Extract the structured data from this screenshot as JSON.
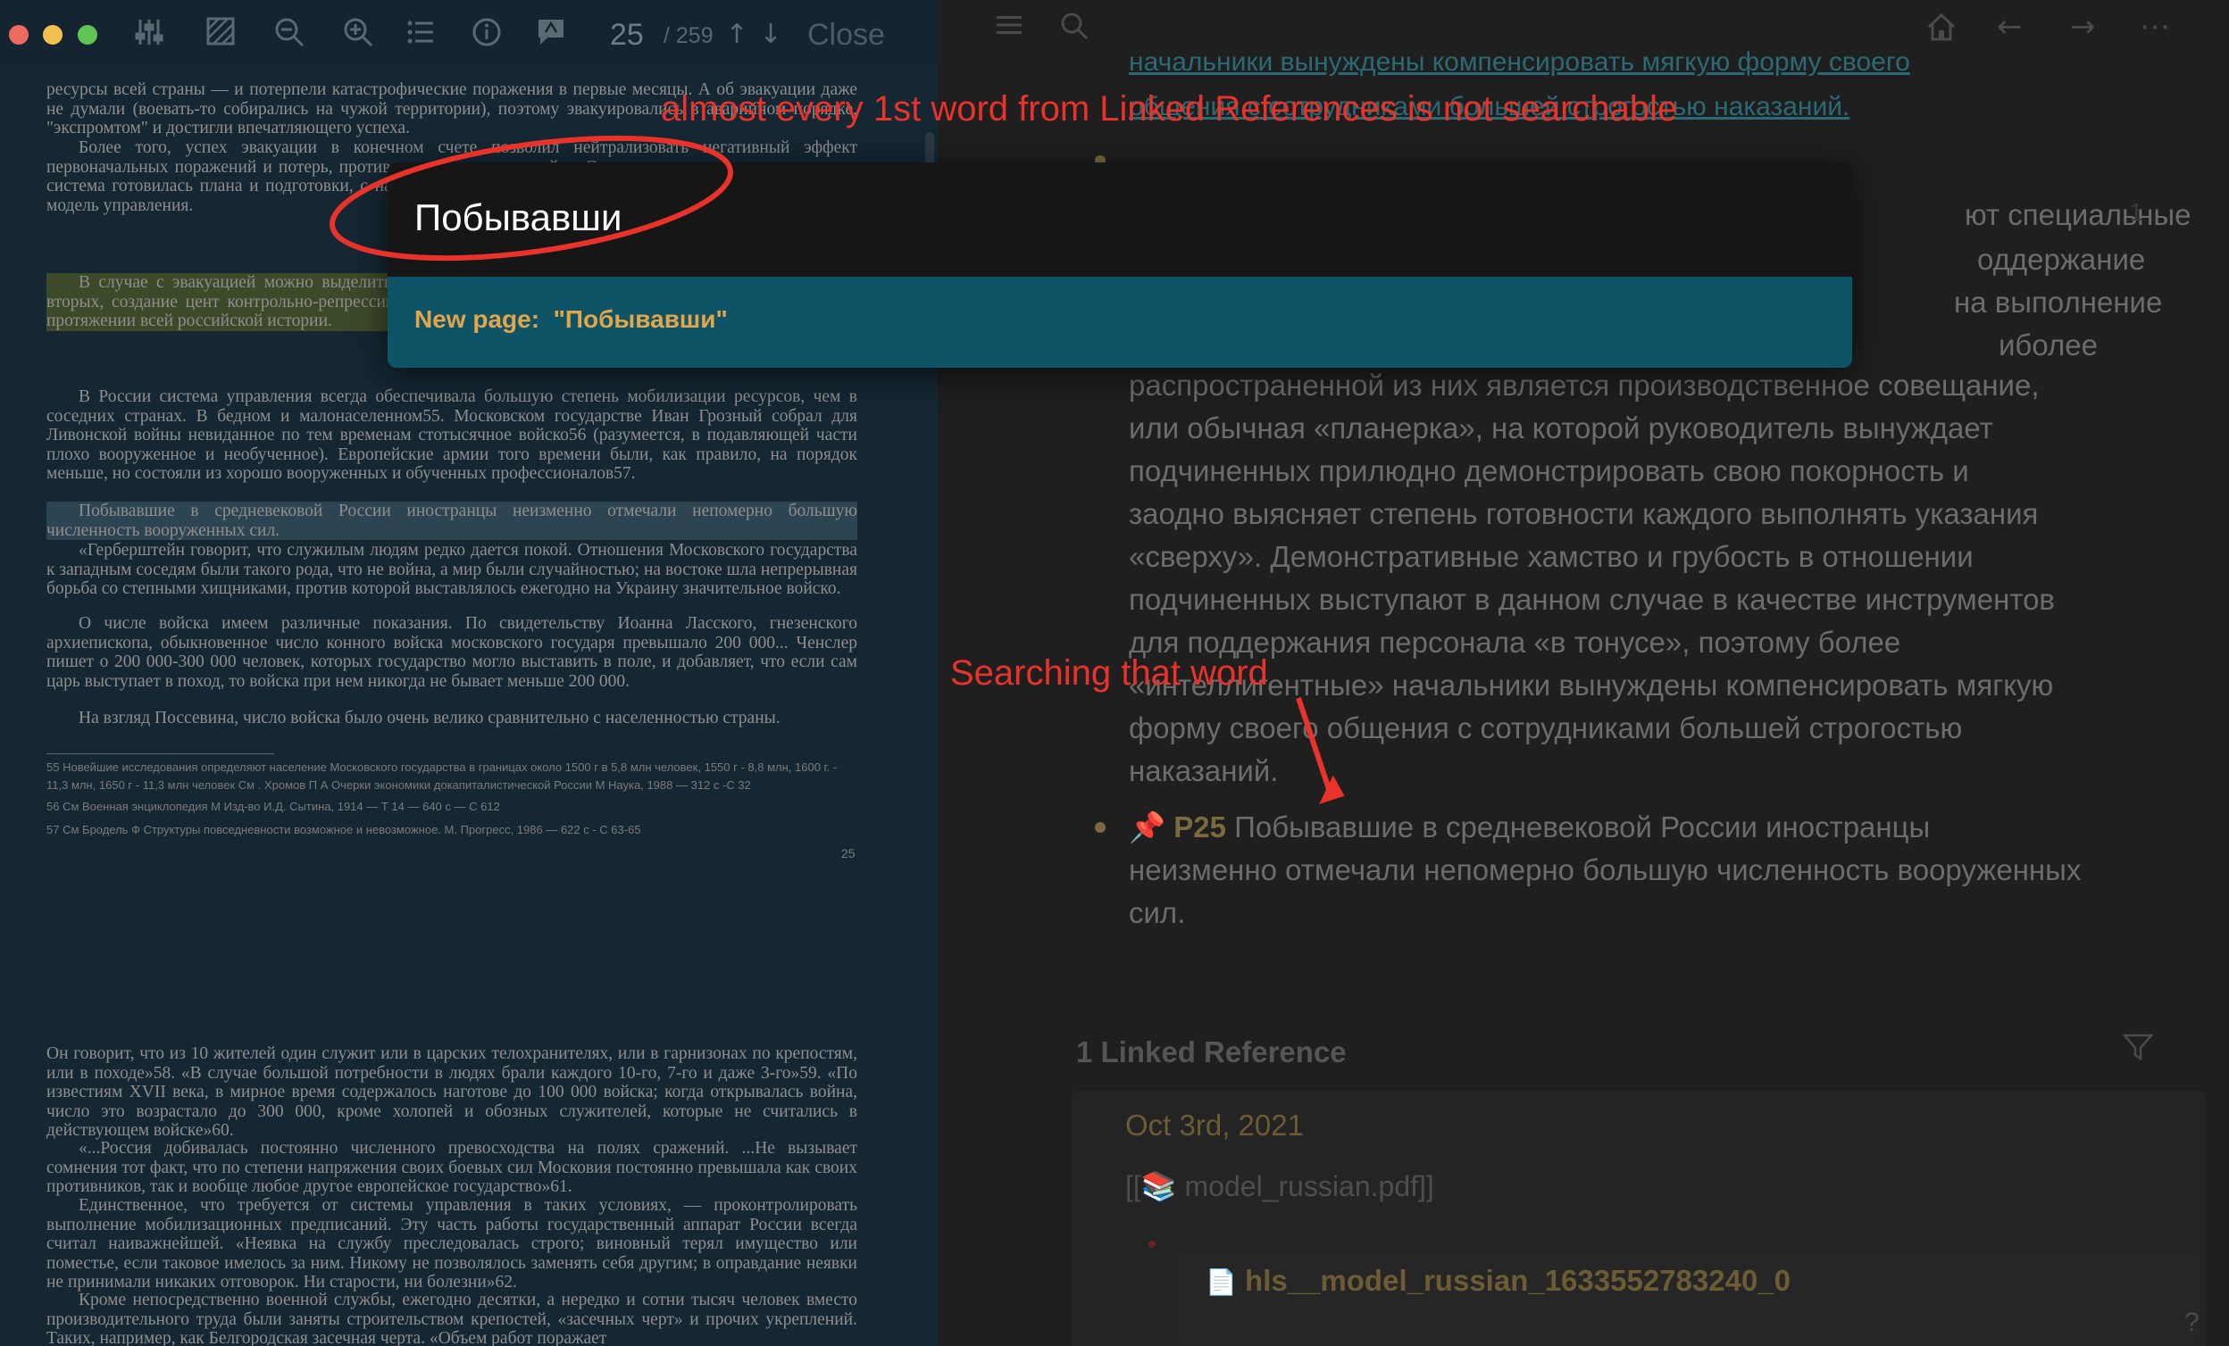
{
  "pdf_viewer": {
    "toolbar": {
      "icons": [
        "settings-sliders-icon",
        "highlight-area-icon",
        "zoom-out-icon",
        "zoom-in-icon",
        "outline-list-icon",
        "info-icon",
        "annotation-icon",
        "up-arrow-icon",
        "down-arrow-icon"
      ],
      "page_current": "25",
      "page_total": "/ 259",
      "close_label": "Close"
    },
    "paragraphs": [
      "ресурсы всей страны — и потерпели катастрофические поражения в первые месяцы. А об эвакуации даже не думали (воевать-то собирались на чужой территории), поэтому эвакуировались в аварийном порядке, \"экспромтом\" и достигли впечатляющего успеха.",
      "Более того, успех эвакуации в конечном счете позволил нейтрализовать негативный эффект первоначальных поражений и потерь, противником и выиграть войну. Одни и те же провалили то, к чему система готовилась плана и подготовки, с наибольшей степенью пирамиды. Указанный парадокс — одно модель управления.",
      "В случае с эвакуацией можно выделить положительный результат: во-первых, мо направления; во-вторых, создание цент контрольно-репрессивных) структур; в-т факторы имели решающее значение и в протяжении всей российской истории.",
      "В России система управления всегда обеспечивала большую степень мобилизации ресурсов, чем в соседних странах. В бедном и малонаселенном55. Московском государстве Иван Грозный собрал для Ливонской войны невиданное по тем временам стотысячное войско56 (разумеется, в подавляющей части плохо вооруженное и необученное). Европейские армии того времени были, как правило, на порядок меньше, но состояли из хорошо вооруженных и обученных профессионалов57.",
      "Побывавшие в средневековой России иностранцы неизменно отмечали непомерно большую численность вооруженных сил.",
      "«Герберштейн говорит, что служилым людям редко дается покой. Отношения Московского государства к западным соседям были такого рода, что не война, а мир были случайностью; на востоке шла непрерывная борьба со степными хищниками, против которой выставлялось ежегодно на Украину значительное войско.",
      "О числе войска имеем различные показания. По свидетельству Иоанна Ласского, гнезенского архиепископа, обыкновенное число конного войска московского государя превышало 200 000... Ченслер пишет о 200 000-300 000 человек, которых государство могло выставить в поле, и добавляет, что если сам царь выступает в поход, то войска при нем никогда не бывает меньше 200 000.",
      "На взгляд Поссевина, число войска было очень велико сравнительно с населенностью страны."
    ],
    "footnotes": [
      "55 Новейшие исследования определяют население Московского государства в границах около 1500 г в 5,8 млн человек, 1550 г - 8,8 млн, 1600 г. - 11,3 млн, 1650 г - 11,3 млн человек См . Хромов П А Очерки экономики докапиталистической России М Наука, 1988 — 312 с -С 32",
      "56 См Военная энциклопедия М Изд-во И.Д. Сытина, 1914 — Т 14 — 640 с — С 612",
      "57 См Бродель Ф Структуры повседневности возможное и невозможное. М. Прогресс, 1986 — 622 с - С 63-65"
    ],
    "page_footer": "25",
    "next_page_paragraphs": [
      "Он говорит, что из 10 жителей один служит или в царских телохранителях, или в гарнизонах по крепостям, или в походе»58. «В случае большой потребности в людях брали каждого 10-го, 7-го и даже 3-го»59. «По известиям XVII века, в мирное время содержалось наготове до 100 000 войска; когда открывалась война, число это возрастало до 300 000, кроме холопей и обозных служителей, которые не считались в действующем войске»60.",
      "«...Россия добивалась постоянно численного превосходства на полях сражений. ...Не вызывает сомнения тот факт, что по степени напряжения своих боевых сил Московия постоянно превышала как своих противников, так и вообще любое другое европейское государство»61.",
      "Единственное, что требуется от системы управления в таких условиях, — проконтролировать выполнение мобилизационных предписаний. Эту часть работы государственный аппарат России всегда считал наиважнейшей. «Неявка на службу преследовалась строго; виновный терял имущество или поместье, если таковое имелось за ним. Никому не позволялось заменять себя другим; в оправдание неявки не принимали никаких отговорок. Ни старости, ни болезни»62.",
      "Кроме непосредственно военной службы, ежегодно десятки, а нередко и сотни тысяч человек вместо производительного труда были заняты строительством крепостей, «засечных черт» и прочих укреплений. Таких, например, как Белгородская засечная черта. «Объем работ поражает"
    ]
  },
  "main": {
    "top_icons": [
      "menu-icon",
      "search-icon",
      "home-icon",
      "back-arrow-icon",
      "forward-arrow-icon",
      "more-icon"
    ],
    "prev_block_line1": "начальники вынуждены компенсировать мягкую форму своего",
    "prev_block_line2": "общения с сотрудниками большей строгостью наказаний.",
    "block_fragments": [
      "ют специальные",
      "оддержание",
      "на выполнение",
      "иболее"
    ],
    "block_ref_count": "1",
    "block_lines": [
      "распространенной из них является производственное совещание,",
      "или обычная «планерка», на которой руководитель вынуждает",
      "подчиненных прилюдно демонстрировать свою покорность и",
      "заодно выясняет степень готовности каждого выполнять указания",
      "«сверху». Демонстративные хамство и грубость в отношении",
      "подчиненных выступают в данном случае в качестве инструментов",
      "для поддержания персонала «в тонусе», поэтому более",
      "«интеллигентные» начальники вынуждены компенсировать мягкую",
      "форму своего общения с сотрудниками большей строгостью",
      "наказаний."
    ],
    "p25_label": "P25",
    "p25_lines": [
      "Побывавшие в средневековой России иностранцы",
      "неизменно отмечали непомерно большую численность вооруженных",
      "сил."
    ],
    "linked_refs": {
      "header": "1 Linked Reference",
      "date": "Oct 3rd, 2021",
      "pdf_link": "[[📚 model_russian.pdf]]",
      "file_name": "hls__model_russian_1633552783240_0"
    },
    "help_label": "?"
  },
  "search": {
    "query": "Побывавши",
    "result_label": "New page:  \"Побывавши\""
  },
  "annotations": {
    "top_note": "almost every 1st word from Linked References is not searchable",
    "arrow_note": "Searching that word",
    "color": "#e8322a"
  }
}
